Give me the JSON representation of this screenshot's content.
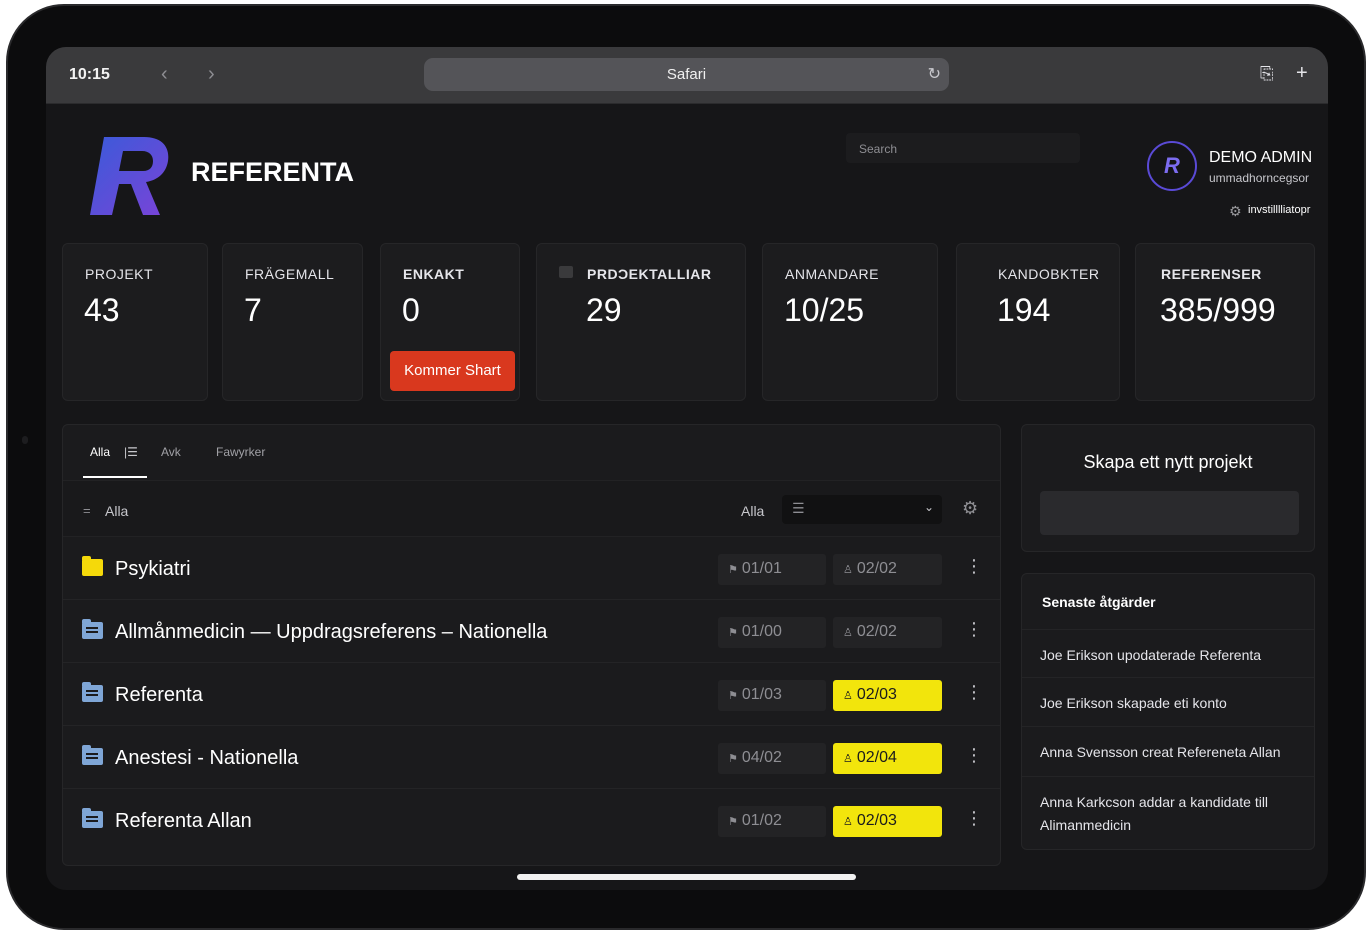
{
  "browser": {
    "time": "10:15",
    "url_label": "Safari"
  },
  "app": {
    "brand": "REFERENTA",
    "logo_letter": "R",
    "search_placeholder": "Search",
    "user": {
      "avatar_letter": "R",
      "name": "DEMO ADMIN",
      "email": "ummadhorncegsor",
      "settings_label": "invstilllliatopr"
    }
  },
  "stats": [
    {
      "title": "PROJEKT",
      "value": "43"
    },
    {
      "title": "FRÄGEMALL",
      "value": "7"
    },
    {
      "title": "ENKAKT",
      "value": "0",
      "button": "Kommer Shart"
    },
    {
      "title": "PRDϽEKTALLIAR",
      "value": "29"
    },
    {
      "title": "ANMANDARE",
      "value": "10/25"
    },
    {
      "title": "KANDOBKTER",
      "value": "194"
    },
    {
      "title": "REFERENSER",
      "value": "385/999"
    }
  ],
  "projects": {
    "tabs": [
      "Alla",
      "Avk",
      "Fawyrker"
    ],
    "filter_label": "Alla",
    "filter_select_label": "Alla",
    "rows": [
      {
        "name": "Psykiatri",
        "a": "01/01",
        "b": "02/02",
        "highlight": false,
        "folder_color": "#f5d90a"
      },
      {
        "name": "Allmånmedicin — Uppdragsreferens – Nationella",
        "a": "01/00",
        "b": "02/02",
        "highlight": false,
        "folder_color": "#7fa6d6"
      },
      {
        "name": "Referenta",
        "a": "01/03",
        "b": "02/03",
        "highlight": true,
        "folder_color": "#7fa6d6"
      },
      {
        "name": "Anestesi - Nationella",
        "a": "04/02",
        "b": "02/04",
        "highlight": true,
        "folder_color": "#7fa6d6"
      },
      {
        "name": "Referenta Allan",
        "a": "01/02",
        "b": "02/03",
        "highlight": true,
        "folder_color": "#7fa6d6"
      }
    ]
  },
  "create_project": {
    "title": "Skapa ett nytt projekt"
  },
  "recent": {
    "title": "Senaste åtgärder",
    "items": [
      "Joe Erikson upodaterade Referenta",
      "Joe Erikson skapade eti konto",
      "Anna Svensson creat Refereneta Allan",
      "Anna Karkcson addar a kandidate till Alimanmedicin"
    ]
  },
  "colors": {
    "accent_red": "#d9381e",
    "highlight_yellow": "#f2e50c",
    "avatar_ring": "#5a4ad6"
  }
}
